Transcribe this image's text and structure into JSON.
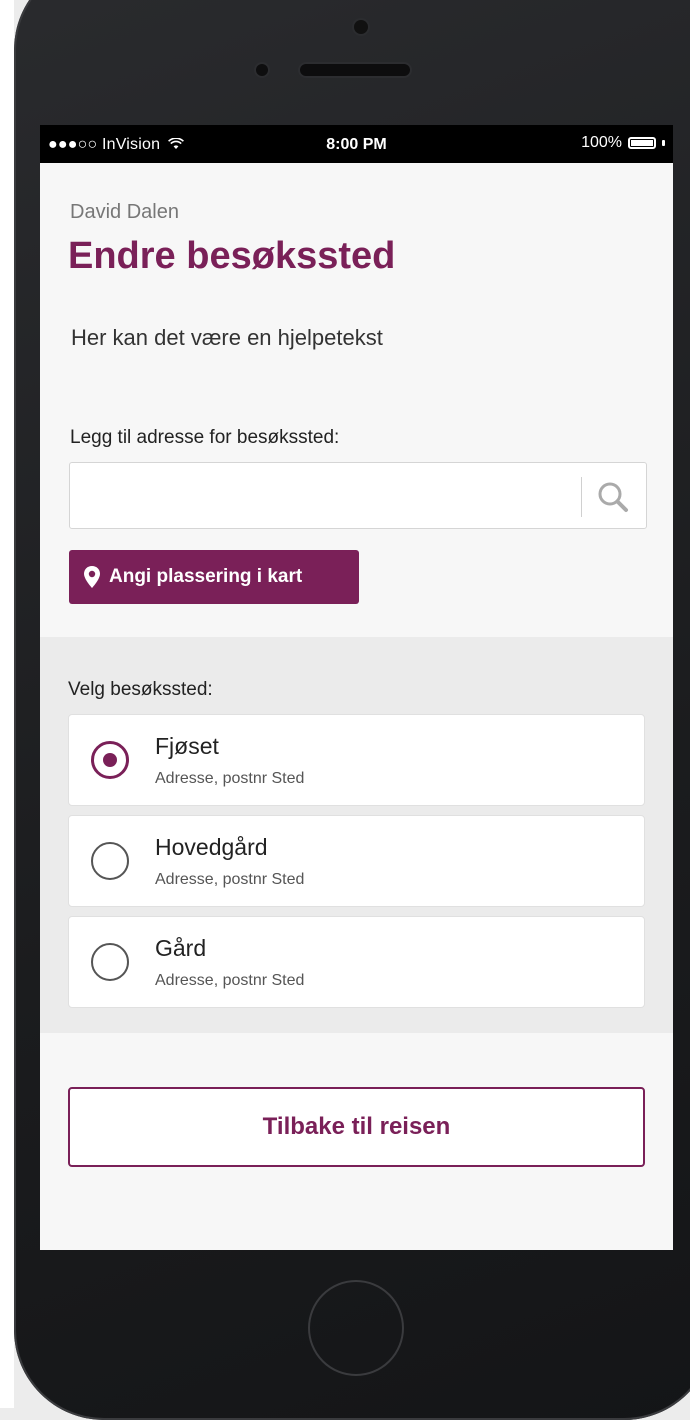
{
  "status_bar": {
    "carrier": "●●●○○ InVision",
    "time": "8:00 PM",
    "battery": "100%",
    "icons": [
      "wifi-icon",
      "battery-icon"
    ]
  },
  "header": {
    "user_name": "David Dalen",
    "title": "Endre besøkssted",
    "helptext": "Her kan det være en hjelpetekst"
  },
  "address": {
    "label": "Legg til adresse for besøkssted:",
    "value": "",
    "placeholder": "",
    "search_icon": "search-icon"
  },
  "map_button": {
    "label": "Angi plassering i kart",
    "icon": "map-pin-icon"
  },
  "choices": {
    "label": "Velg besøkssted:",
    "items": [
      {
        "name": "Fjøset",
        "address": "Adresse, postnr Sted",
        "selected": true
      },
      {
        "name": "Hovedgård",
        "address": "Adresse, postnr Sted",
        "selected": false
      },
      {
        "name": "Gård",
        "address": "Adresse, postnr Sted",
        "selected": false
      }
    ]
  },
  "back_button": {
    "label": "Tilbake til reisen"
  },
  "colors": {
    "accent": "#7a2058",
    "phone_body": "#1f2022",
    "screen_bg": "#f7f7f7",
    "section_bg": "#ebebeb"
  }
}
